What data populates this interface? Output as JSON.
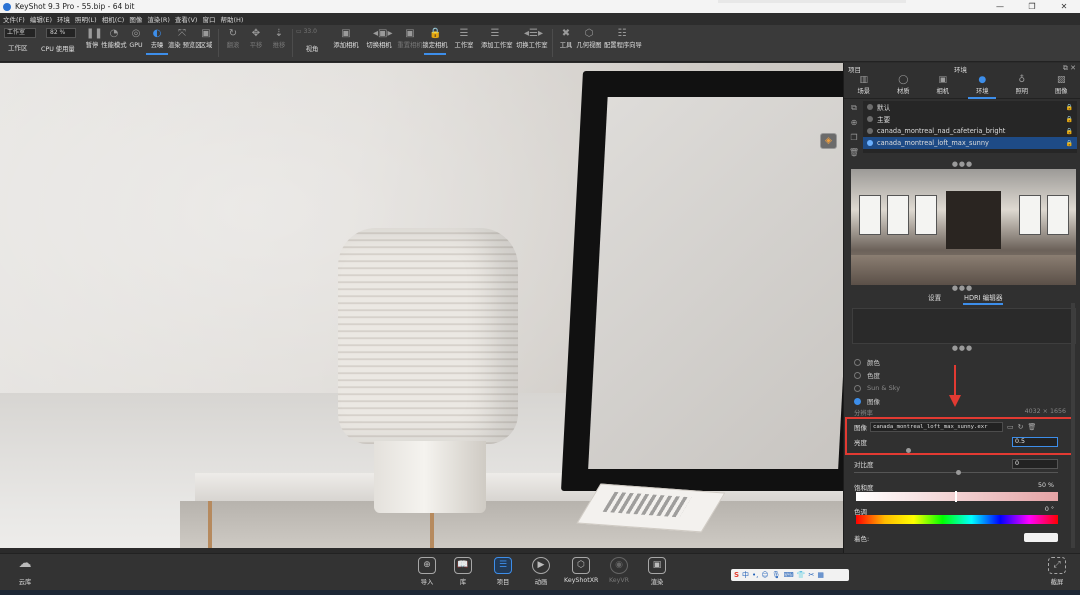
{
  "titlebar": {
    "title": "KeyShot 9.3 Pro  -  55.bip  -  64 bit",
    "controls": [
      "—",
      "❐",
      "✕"
    ]
  },
  "menu": [
    "文件(F)",
    "编辑(E)",
    "环境",
    "照明(L)",
    "相机(C)",
    "图像",
    "渲染(R)",
    "查看(V)",
    "窗口",
    "帮助(H)"
  ],
  "toolbar": {
    "workspace_select": "工作室",
    "workspace_label": "工作区",
    "cpu_value": "82 %",
    "items": [
      {
        "label": "CPU 使用量",
        "icon": "cpu-icon"
      },
      {
        "label": "暂停",
        "icon": "pause-icon"
      },
      {
        "label": "性能模式",
        "icon": "performance-icon"
      },
      {
        "label": "GPU",
        "icon": "gpu-icon"
      },
      {
        "label": "去噪",
        "icon": "denoise-icon"
      },
      {
        "label": "渲染 预览区",
        "icon": "render-region-icon"
      },
      {
        "label": "区域",
        "icon": "region-icon"
      },
      {
        "label": "翻滚",
        "icon": "tumble-icon"
      },
      {
        "label": "平移",
        "icon": "pan-icon"
      },
      {
        "label": "推移",
        "icon": "dolly-icon"
      },
      {
        "label": "视角",
        "icon": "fov-icon"
      },
      {
        "label": "添加相机",
        "icon": "add-camera-icon"
      },
      {
        "label": "切换相机",
        "icon": "switch-camera-icon"
      },
      {
        "label": "重置相机",
        "icon": "reset-camera-icon"
      },
      {
        "label": "锁定相机",
        "icon": "lock-camera-icon"
      },
      {
        "label": "工作室",
        "icon": "studio-icon"
      },
      {
        "label": "添加工作室",
        "icon": "add-studio-icon"
      },
      {
        "label": "切换工作室",
        "icon": "switch-studio-icon"
      },
      {
        "label": "工具",
        "icon": "tools-icon"
      },
      {
        "label": "几何视图",
        "icon": "geometry-view-icon"
      },
      {
        "label": "配置程序向导",
        "icon": "configurator-icon"
      }
    ],
    "fov_value": "33.0"
  },
  "panel": {
    "project_label": "项目",
    "title": "环境",
    "tabs": [
      "场景",
      "材质",
      "相机",
      "环境",
      "照明",
      "图像"
    ],
    "environments": [
      {
        "name": "默认",
        "selected": false
      },
      {
        "name": "主要",
        "selected": false
      },
      {
        "name": "canada_montreal_nad_cafeteria_bright",
        "selected": false
      },
      {
        "name": "canada_montreal_loft_max_sunny",
        "selected": true
      }
    ],
    "subtabs": [
      "设置",
      "HDRI 编辑器"
    ],
    "background_options": [
      {
        "label": "颜色",
        "selected": false
      },
      {
        "label": "色度",
        "selected": false
      },
      {
        "label": "Sun & Sky",
        "selected": false
      },
      {
        "label": "图像",
        "selected": true
      }
    ],
    "resolution_label": "分辨率",
    "resolution_value": "4032 × 1656",
    "image_label": "图像",
    "image_file": "canada_montreal_loft_max_sunny.exr",
    "brightness_label": "亮度",
    "brightness_value": "0.5",
    "contrast_label": "对比度",
    "contrast_value": "0",
    "saturation_label": "饱和度",
    "saturation_value": "50 %",
    "hue_label": "色调",
    "hue_value": "0 °",
    "tint_label": "着色:"
  },
  "dock": {
    "cloud_library": "云库",
    "items": [
      {
        "label": "导入",
        "icon": "import-icon",
        "active": false,
        "dim": false
      },
      {
        "label": "库",
        "icon": "library-icon",
        "active": false,
        "dim": false
      },
      {
        "label": "项目",
        "icon": "project-icon",
        "active": true,
        "dim": false
      },
      {
        "label": "动画",
        "icon": "animation-icon",
        "active": false,
        "dim": false
      },
      {
        "label": "KeyShotXR",
        "icon": "keyshotxr-icon",
        "active": false,
        "dim": false
      },
      {
        "label": "KeyVR",
        "icon": "keyvr-icon",
        "active": false,
        "dim": true
      },
      {
        "label": "渲染",
        "icon": "render-icon",
        "active": false,
        "dim": false
      }
    ],
    "screenshot_label": "截屏"
  },
  "ime": {
    "logo": "S",
    "items": [
      "中",
      "•,",
      "☺",
      "🎙",
      "⌨",
      "👕",
      "✂",
      "▦"
    ]
  },
  "colors": {
    "accent": "#3d8eea",
    "highlight": "#e23a32",
    "selected_row": "#1e4b86"
  }
}
